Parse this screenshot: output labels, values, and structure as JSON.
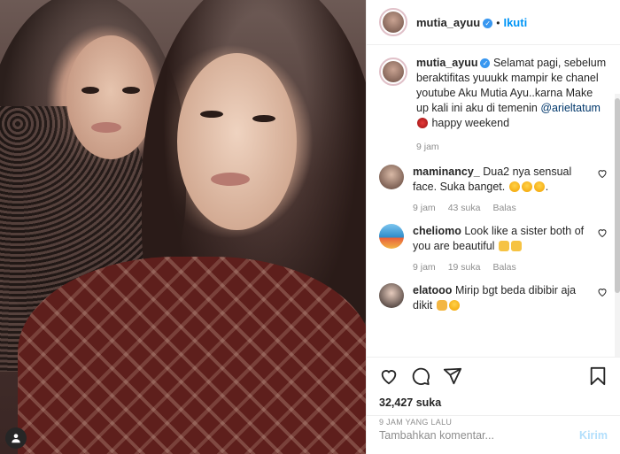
{
  "colors": {
    "accent": "#0095f6",
    "muted": "#8e8e8e",
    "text": "#262626",
    "mention": "#00376b"
  },
  "header": {
    "username": "mutia_ayuu",
    "separator": "•",
    "follow_label": "Ikuti"
  },
  "caption": {
    "username": "mutia_ayuu",
    "text_before": "Selamat pagi, sebelum beraktifitas yuuukk mampir ke chanel youtube Aku Mutia Ayu..karna Make up kali ini aku di temenin ",
    "mention": "@arieltatum",
    "text_after": " happy weekend",
    "time": "9 jam"
  },
  "comments": [
    {
      "username": "maminancy_",
      "text": "Dua2 nya sensual face. Suka banget. ",
      "time": "9 jam",
      "likes": "43 suka",
      "reply": "Balas"
    },
    {
      "username": "cheliomo",
      "text": "Look like a sister both of you are beautiful ",
      "time": "9 jam",
      "likes": "19 suka",
      "reply": "Balas"
    },
    {
      "username": "elatooo",
      "text": "Mirip bgt beda dibibir aja dikit "
    }
  ],
  "actions": {
    "likes": "32,427 suka",
    "ago": "9 JAM YANG LALU"
  },
  "add_comment": {
    "placeholder": "Tambahkan komentar...",
    "post_label": "Kirim"
  },
  "icons": [
    "user-tag-icon",
    "verified-icon",
    "heart-icon",
    "comment-icon",
    "share-icon",
    "bookmark-icon"
  ]
}
